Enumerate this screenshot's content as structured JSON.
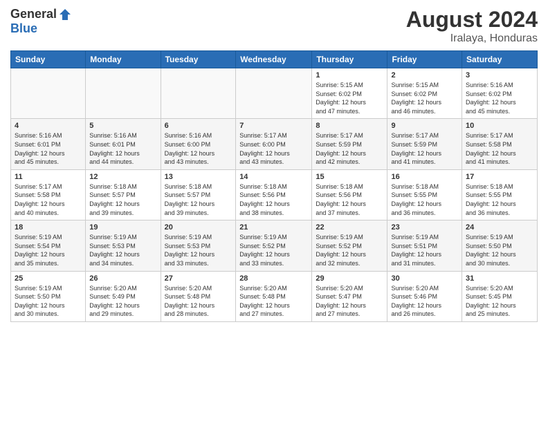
{
  "logo": {
    "general": "General",
    "blue": "Blue"
  },
  "title": {
    "month_year": "August 2024",
    "location": "Iralaya, Honduras"
  },
  "headers": [
    "Sunday",
    "Monday",
    "Tuesday",
    "Wednesday",
    "Thursday",
    "Friday",
    "Saturday"
  ],
  "weeks": [
    [
      {
        "day": "",
        "info": ""
      },
      {
        "day": "",
        "info": ""
      },
      {
        "day": "",
        "info": ""
      },
      {
        "day": "",
        "info": ""
      },
      {
        "day": "1",
        "info": "Sunrise: 5:15 AM\nSunset: 6:02 PM\nDaylight: 12 hours\nand 47 minutes."
      },
      {
        "day": "2",
        "info": "Sunrise: 5:15 AM\nSunset: 6:02 PM\nDaylight: 12 hours\nand 46 minutes."
      },
      {
        "day": "3",
        "info": "Sunrise: 5:16 AM\nSunset: 6:02 PM\nDaylight: 12 hours\nand 45 minutes."
      }
    ],
    [
      {
        "day": "4",
        "info": "Sunrise: 5:16 AM\nSunset: 6:01 PM\nDaylight: 12 hours\nand 45 minutes."
      },
      {
        "day": "5",
        "info": "Sunrise: 5:16 AM\nSunset: 6:01 PM\nDaylight: 12 hours\nand 44 minutes."
      },
      {
        "day": "6",
        "info": "Sunrise: 5:16 AM\nSunset: 6:00 PM\nDaylight: 12 hours\nand 43 minutes."
      },
      {
        "day": "7",
        "info": "Sunrise: 5:17 AM\nSunset: 6:00 PM\nDaylight: 12 hours\nand 43 minutes."
      },
      {
        "day": "8",
        "info": "Sunrise: 5:17 AM\nSunset: 5:59 PM\nDaylight: 12 hours\nand 42 minutes."
      },
      {
        "day": "9",
        "info": "Sunrise: 5:17 AM\nSunset: 5:59 PM\nDaylight: 12 hours\nand 41 minutes."
      },
      {
        "day": "10",
        "info": "Sunrise: 5:17 AM\nSunset: 5:58 PM\nDaylight: 12 hours\nand 41 minutes."
      }
    ],
    [
      {
        "day": "11",
        "info": "Sunrise: 5:17 AM\nSunset: 5:58 PM\nDaylight: 12 hours\nand 40 minutes."
      },
      {
        "day": "12",
        "info": "Sunrise: 5:18 AM\nSunset: 5:57 PM\nDaylight: 12 hours\nand 39 minutes."
      },
      {
        "day": "13",
        "info": "Sunrise: 5:18 AM\nSunset: 5:57 PM\nDaylight: 12 hours\nand 39 minutes."
      },
      {
        "day": "14",
        "info": "Sunrise: 5:18 AM\nSunset: 5:56 PM\nDaylight: 12 hours\nand 38 minutes."
      },
      {
        "day": "15",
        "info": "Sunrise: 5:18 AM\nSunset: 5:56 PM\nDaylight: 12 hours\nand 37 minutes."
      },
      {
        "day": "16",
        "info": "Sunrise: 5:18 AM\nSunset: 5:55 PM\nDaylight: 12 hours\nand 36 minutes."
      },
      {
        "day": "17",
        "info": "Sunrise: 5:18 AM\nSunset: 5:55 PM\nDaylight: 12 hours\nand 36 minutes."
      }
    ],
    [
      {
        "day": "18",
        "info": "Sunrise: 5:19 AM\nSunset: 5:54 PM\nDaylight: 12 hours\nand 35 minutes."
      },
      {
        "day": "19",
        "info": "Sunrise: 5:19 AM\nSunset: 5:53 PM\nDaylight: 12 hours\nand 34 minutes."
      },
      {
        "day": "20",
        "info": "Sunrise: 5:19 AM\nSunset: 5:53 PM\nDaylight: 12 hours\nand 33 minutes."
      },
      {
        "day": "21",
        "info": "Sunrise: 5:19 AM\nSunset: 5:52 PM\nDaylight: 12 hours\nand 33 minutes."
      },
      {
        "day": "22",
        "info": "Sunrise: 5:19 AM\nSunset: 5:52 PM\nDaylight: 12 hours\nand 32 minutes."
      },
      {
        "day": "23",
        "info": "Sunrise: 5:19 AM\nSunset: 5:51 PM\nDaylight: 12 hours\nand 31 minutes."
      },
      {
        "day": "24",
        "info": "Sunrise: 5:19 AM\nSunset: 5:50 PM\nDaylight: 12 hours\nand 30 minutes."
      }
    ],
    [
      {
        "day": "25",
        "info": "Sunrise: 5:19 AM\nSunset: 5:50 PM\nDaylight: 12 hours\nand 30 minutes."
      },
      {
        "day": "26",
        "info": "Sunrise: 5:20 AM\nSunset: 5:49 PM\nDaylight: 12 hours\nand 29 minutes."
      },
      {
        "day": "27",
        "info": "Sunrise: 5:20 AM\nSunset: 5:48 PM\nDaylight: 12 hours\nand 28 minutes."
      },
      {
        "day": "28",
        "info": "Sunrise: 5:20 AM\nSunset: 5:48 PM\nDaylight: 12 hours\nand 27 minutes."
      },
      {
        "day": "29",
        "info": "Sunrise: 5:20 AM\nSunset: 5:47 PM\nDaylight: 12 hours\nand 27 minutes."
      },
      {
        "day": "30",
        "info": "Sunrise: 5:20 AM\nSunset: 5:46 PM\nDaylight: 12 hours\nand 26 minutes."
      },
      {
        "day": "31",
        "info": "Sunrise: 5:20 AM\nSunset: 5:45 PM\nDaylight: 12 hours\nand 25 minutes."
      }
    ]
  ]
}
